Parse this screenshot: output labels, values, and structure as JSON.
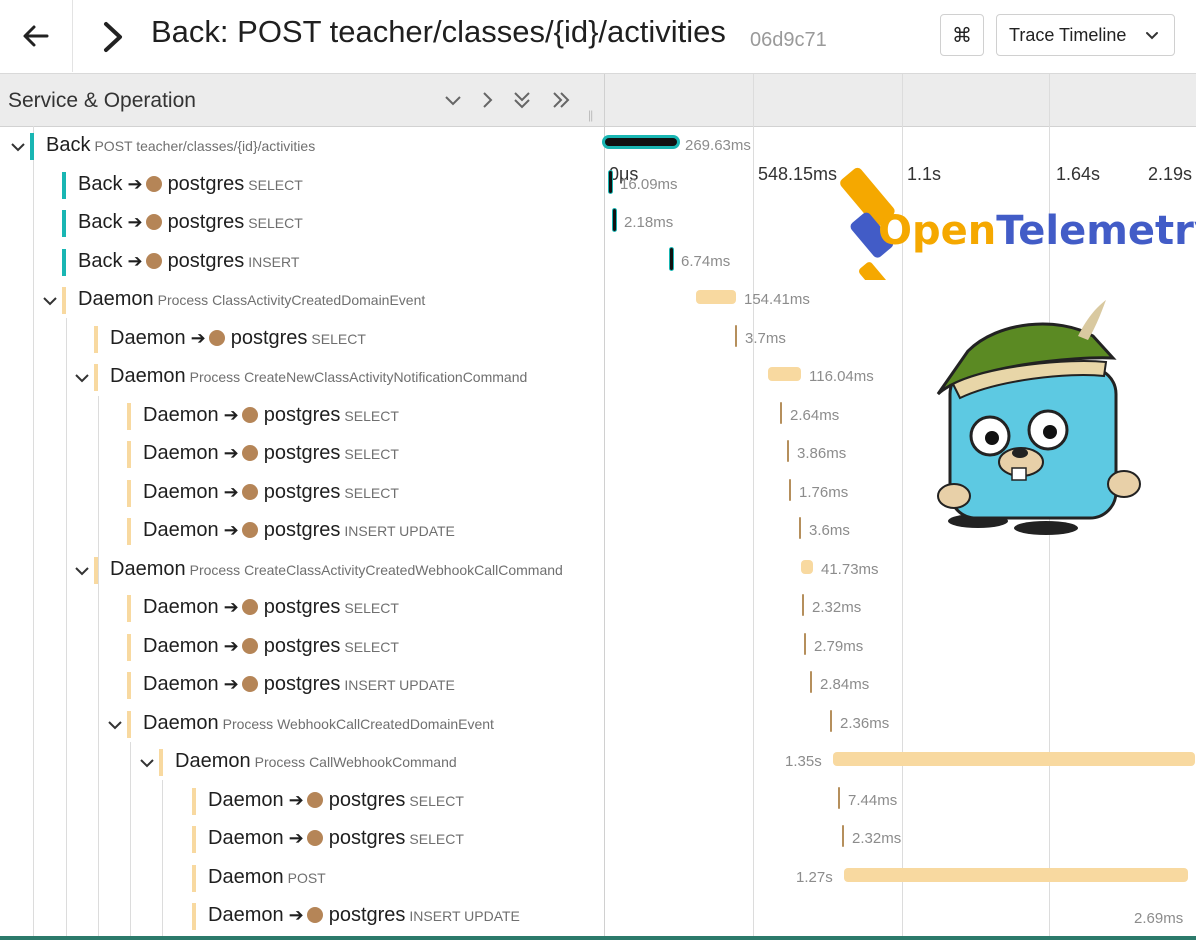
{
  "header": {
    "title": "Back: POST teacher/classes/{id}/activities",
    "trace_id": "06d9c71",
    "shortcut_symbol": "⌘",
    "view_mode": "Trace Timeline"
  },
  "columns": {
    "label": "Service & Operation",
    "ticks": [
      "0μs",
      "548.15ms",
      "1.1s",
      "1.64s",
      "2.19s"
    ]
  },
  "colors": {
    "back": "#19b6b3",
    "daemon": "#f8d9a0",
    "postgres_dot": "#b58557"
  },
  "logo": {
    "open": "Open",
    "telemetry": "Telemetry"
  },
  "spans": [
    {
      "service": "Back",
      "db": "",
      "op": "POST teacher/classes/{id}/activities",
      "kw": "",
      "depth": 0,
      "toggle": true,
      "duration": "269.63ms"
    },
    {
      "service": "Back",
      "db": "postgres",
      "op": "",
      "kw": "SELECT",
      "depth": 1,
      "toggle": false,
      "duration": "16.09ms"
    },
    {
      "service": "Back",
      "db": "postgres",
      "op": "",
      "kw": "SELECT",
      "depth": 1,
      "toggle": false,
      "duration": "2.18ms"
    },
    {
      "service": "Back",
      "db": "postgres",
      "op": "",
      "kw": "INSERT",
      "depth": 1,
      "toggle": false,
      "duration": "6.74ms"
    },
    {
      "service": "Daemon",
      "db": "",
      "op": "Process ClassActivityCreatedDomainEvent",
      "kw": "",
      "depth": 1,
      "toggle": true,
      "duration": "154.41ms"
    },
    {
      "service": "Daemon",
      "db": "postgres",
      "op": "",
      "kw": "SELECT",
      "depth": 2,
      "toggle": false,
      "duration": "3.7ms"
    },
    {
      "service": "Daemon",
      "db": "",
      "op": "Process CreateNewClassActivityNotificationCommand",
      "kw": "",
      "depth": 2,
      "toggle": true,
      "duration": "116.04ms"
    },
    {
      "service": "Daemon",
      "db": "postgres",
      "op": "",
      "kw": "SELECT",
      "depth": 3,
      "toggle": false,
      "duration": "2.64ms"
    },
    {
      "service": "Daemon",
      "db": "postgres",
      "op": "",
      "kw": "SELECT",
      "depth": 3,
      "toggle": false,
      "duration": "3.86ms"
    },
    {
      "service": "Daemon",
      "db": "postgres",
      "op": "",
      "kw": "SELECT",
      "depth": 3,
      "toggle": false,
      "duration": "1.76ms"
    },
    {
      "service": "Daemon",
      "db": "postgres",
      "op": "",
      "kw": "INSERT UPDATE",
      "depth": 3,
      "toggle": false,
      "duration": "3.6ms"
    },
    {
      "service": "Daemon",
      "db": "",
      "op": "Process CreateClassActivityCreatedWebhookCallCommand",
      "kw": "",
      "depth": 2,
      "toggle": true,
      "duration": "41.73ms"
    },
    {
      "service": "Daemon",
      "db": "postgres",
      "op": "",
      "kw": "SELECT",
      "depth": 3,
      "toggle": false,
      "duration": "2.32ms"
    },
    {
      "service": "Daemon",
      "db": "postgres",
      "op": "",
      "kw": "SELECT",
      "depth": 3,
      "toggle": false,
      "duration": "2.79ms"
    },
    {
      "service": "Daemon",
      "db": "postgres",
      "op": "",
      "kw": "INSERT UPDATE",
      "depth": 3,
      "toggle": false,
      "duration": "2.84ms"
    },
    {
      "service": "Daemon",
      "db": "",
      "op": "Process WebhookCallCreatedDomainEvent",
      "kw": "",
      "depth": 3,
      "toggle": true,
      "duration": "2.36ms"
    },
    {
      "service": "Daemon",
      "db": "",
      "op": "Process CallWebhookCommand",
      "kw": "",
      "depth": 4,
      "toggle": true,
      "duration": "1.35s"
    },
    {
      "service": "Daemon",
      "db": "postgres",
      "op": "",
      "kw": "SELECT",
      "depth": 5,
      "toggle": false,
      "duration": "7.44ms"
    },
    {
      "service": "Daemon",
      "db": "postgres",
      "op": "",
      "kw": "SELECT",
      "depth": 5,
      "toggle": false,
      "duration": "2.32ms"
    },
    {
      "service": "Daemon",
      "db": "",
      "op": "POST",
      "kw": "",
      "depth": 5,
      "toggle": false,
      "duration": "1.27s"
    },
    {
      "service": "Daemon",
      "db": "postgres",
      "op": "",
      "kw": "INSERT UPDATE",
      "depth": 5,
      "toggle": false,
      "duration": "2.69ms"
    }
  ]
}
